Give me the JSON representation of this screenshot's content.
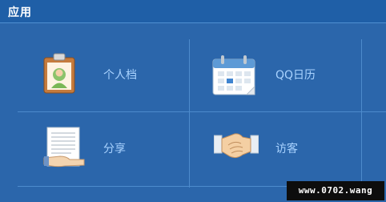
{
  "header": {
    "title": "应用"
  },
  "apps": [
    {
      "label": "个人档",
      "icon": "profile-clipboard-icon"
    },
    {
      "label": "QQ日历",
      "icon": "calendar-icon"
    },
    {
      "label": "分享",
      "icon": "share-document-icon"
    },
    {
      "label": "访客",
      "icon": "handshake-icon"
    }
  ],
  "watermark": {
    "text": "www.0702.wang"
  },
  "colors": {
    "background": "#2a67ad",
    "titlebar": "#1f5fa7",
    "label": "#a9d3ff",
    "gridline": "#4d8bcc"
  }
}
